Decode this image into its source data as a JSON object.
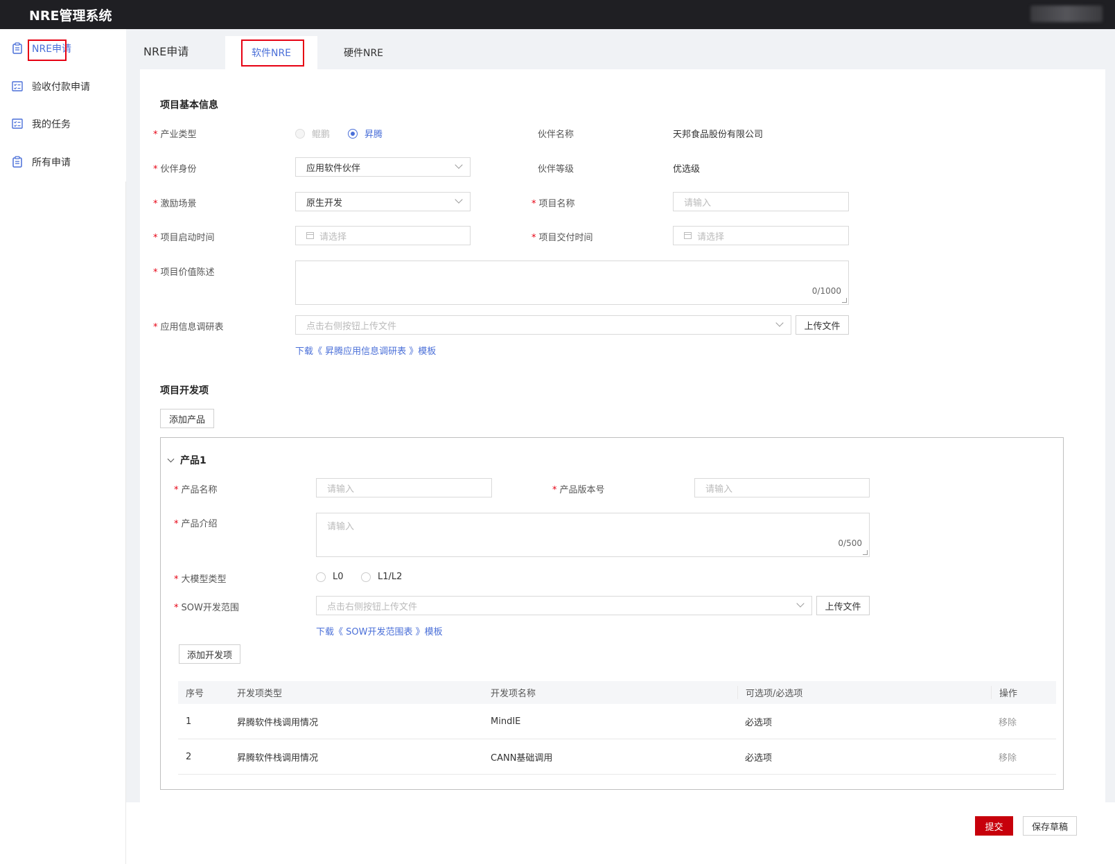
{
  "app": {
    "title": "NRE管理系统"
  },
  "sidebar": {
    "items": [
      {
        "label": "NRE申请",
        "icon": "clipboard-icon"
      },
      {
        "label": "验收付款申请",
        "icon": "checklist-icon"
      },
      {
        "label": "我的任务",
        "icon": "checklist-icon"
      },
      {
        "label": "所有申请",
        "icon": "clipboard-icon"
      }
    ]
  },
  "page": {
    "title": "NRE申请"
  },
  "tabs": [
    {
      "label": "软件NRE"
    },
    {
      "label": "硬件NRE"
    }
  ],
  "basic": {
    "section_title": "项目基本信息",
    "industry_type": {
      "label": "产业类型",
      "options": [
        "鲲鹏",
        "昇腾"
      ],
      "selected": "昇腾"
    },
    "partner_name": {
      "label": "伙伴名称",
      "value": "天邦食品股份有限公司"
    },
    "partner_identity": {
      "label": "伙伴身份",
      "value": "应用软件伙伴"
    },
    "partner_level": {
      "label": "伙伴等级",
      "value": "优选级"
    },
    "incentive": {
      "label": "激励场景",
      "value": "原生开发"
    },
    "project_name": {
      "label": "项目名称",
      "placeholder": "请输入"
    },
    "start_time": {
      "label": "项目启动时间",
      "placeholder": "请选择"
    },
    "delivery_time": {
      "label": "项目交付时间",
      "placeholder": "请选择"
    },
    "value_desc": {
      "label": "项目价值陈述",
      "counter": "0/1000"
    },
    "survey": {
      "label": "应用信息调研表",
      "placeholder": "点击右侧按钮上传文件",
      "upload": "上传文件",
      "download": "下载《 昇腾应用信息调研表 》模板"
    }
  },
  "dev": {
    "section_title": "项目开发项",
    "add_product": "添加产品",
    "product": {
      "title": "产品1",
      "name": {
        "label": "产品名称",
        "placeholder": "请输入"
      },
      "version": {
        "label": "产品版本号",
        "placeholder": "请输入"
      },
      "intro": {
        "label": "产品介绍",
        "placeholder": "请输入",
        "counter": "0/500"
      },
      "model_type": {
        "label": "大模型类型",
        "options": [
          "L0",
          "L1/L2"
        ]
      },
      "sow": {
        "label": "SOW开发范围",
        "placeholder": "点击右侧按钮上传文件",
        "upload": "上传文件",
        "download": "下载《 SOW开发范围表 》模板"
      },
      "add_item": "添加开发项",
      "table": {
        "headers": [
          "序号",
          "开发项类型",
          "开发项名称",
          "可选项/必选项",
          "操作"
        ],
        "rows": [
          [
            "1",
            "昇腾软件栈调用情况",
            "MindIE",
            "必选项",
            "移除"
          ],
          [
            "2",
            "昇腾软件栈调用情况",
            "CANN基础调用",
            "必选项",
            "移除"
          ]
        ]
      }
    }
  },
  "footer": {
    "submit": "提交",
    "save_draft": "保存草稿"
  },
  "colors": {
    "accent": "#4a6fd8",
    "primary_button": "#c7000b",
    "highlight": "#e60012",
    "topbar": "#1f1f23"
  }
}
